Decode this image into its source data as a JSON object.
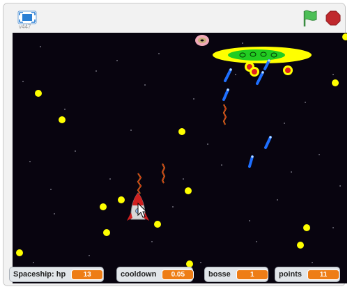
{
  "app": {
    "version": "v447"
  },
  "monitors": [
    {
      "label": "Spaceship: hp",
      "value": "13"
    },
    {
      "label": "cooldown",
      "value": "0.05"
    },
    {
      "label": "bosse",
      "value": "1"
    },
    {
      "label": "points",
      "value": "11"
    }
  ],
  "icons": {
    "fullscreen": "fullscreen-icon",
    "green_flag": "green-flag-icon",
    "stop": "stop-sign-icon"
  },
  "colors": {
    "stage_background": "#08040f",
    "monitor_value": "#ee7d16",
    "flag": "#4cbf56",
    "stop": "#c0282d",
    "coin": "#ffff00",
    "boss_saucer": "#ffff00",
    "boss_core": "#22cc22",
    "player_laser": "#e8a020",
    "enemy_missile": "#1e6fff"
  }
}
